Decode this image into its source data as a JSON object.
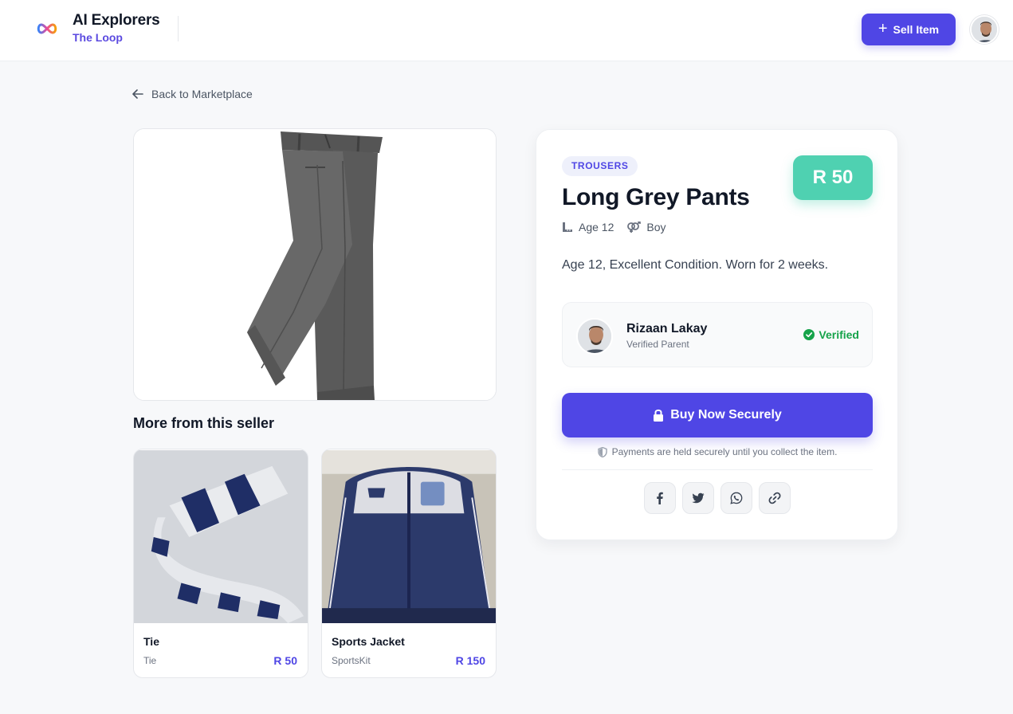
{
  "header": {
    "brand_title": "AI Explorers",
    "brand_subtitle": "The Loop",
    "sell_button": "Sell Item"
  },
  "nav": {
    "back_label": "Back to Marketplace"
  },
  "product": {
    "category": "TROUSERS",
    "title": "Long Grey Pants",
    "price": "R 50",
    "age": "Age 12",
    "gender": "Boy",
    "description": "Age 12, Excellent Condition. Worn for 2 weeks."
  },
  "seller": {
    "name": "Rizaan Lakay",
    "role": "Verified Parent",
    "status": "Verified"
  },
  "actions": {
    "buy_label": "Buy Now Securely",
    "secure_note": "Payments are held securely until you collect the item."
  },
  "share_icons": [
    "facebook-icon",
    "twitter-icon",
    "whatsapp-icon",
    "link-icon"
  ],
  "more_from_seller": {
    "heading": "More from this seller",
    "items": [
      {
        "name": "Tie",
        "category": "Tie",
        "price": "R 50"
      },
      {
        "name": "Sports Jacket",
        "category": "SportsKit",
        "price": "R 150"
      }
    ]
  },
  "colors": {
    "primary": "#4f46e5",
    "price_badge": "#4fd1b1",
    "verified": "#16a34a",
    "background": "#f7f8fa"
  }
}
